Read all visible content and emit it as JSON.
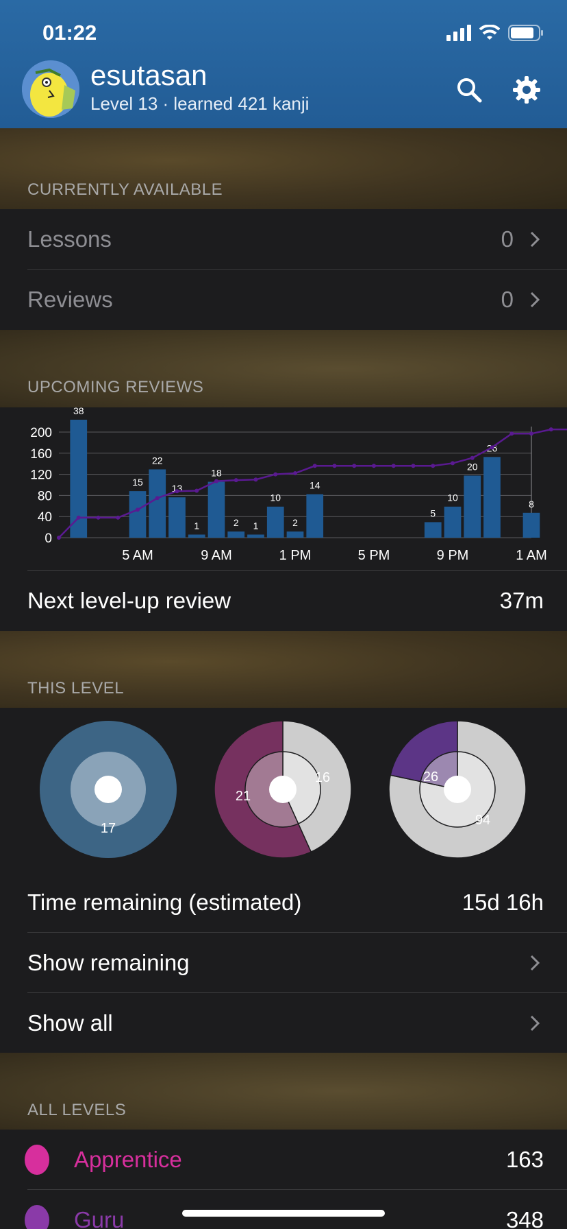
{
  "status_bar": {
    "time": "01:22"
  },
  "header": {
    "username": "esutasan",
    "subtitle": "Level 13 · learned 421 kanji"
  },
  "currently_available": {
    "title": "CURRENTLY AVAILABLE",
    "lessons": {
      "label": "Lessons",
      "value": "0"
    },
    "reviews": {
      "label": "Reviews",
      "value": "0"
    }
  },
  "upcoming_reviews": {
    "title": "UPCOMING REVIEWS"
  },
  "chart_data": {
    "type": "bar",
    "bars": [
      {
        "x": 1,
        "value": 38
      },
      {
        "x": 4,
        "value": 15
      },
      {
        "x": 5,
        "value": 22
      },
      {
        "x": 6,
        "value": 13
      },
      {
        "x": 7,
        "value": 1
      },
      {
        "x": 8,
        "value": 18
      },
      {
        "x": 9,
        "value": 2
      },
      {
        "x": 10,
        "value": 1
      },
      {
        "x": 11,
        "value": 10
      },
      {
        "x": 12,
        "value": 2
      },
      {
        "x": 13,
        "value": 14
      },
      {
        "x": 19,
        "value": 5
      },
      {
        "x": 20,
        "value": 10
      },
      {
        "x": 21,
        "value": 20
      },
      {
        "x": 22,
        "value": 26
      },
      {
        "x": 24,
        "value": 8
      }
    ],
    "bar_scale_max": 38,
    "cumulative_line": [
      0,
      38,
      38,
      38,
      53,
      75,
      88,
      89,
      107,
      109,
      110,
      120,
      122,
      136,
      136,
      136,
      136,
      136,
      136,
      136,
      141,
      151,
      171,
      197,
      197,
      205,
      205
    ],
    "ylim": [
      0,
      200
    ],
    "yticks": [
      200,
      160,
      120,
      80,
      40,
      0
    ],
    "xticks": [
      {
        "x": 4,
        "label": "5 AM"
      },
      {
        "x": 8,
        "label": "9 AM"
      },
      {
        "x": 12,
        "label": "1 PM"
      },
      {
        "x": 16,
        "label": "5 PM"
      },
      {
        "x": 20,
        "label": "9 PM"
      },
      {
        "x": 24,
        "label": "1 AM"
      }
    ],
    "bar_color": "#1f5a93",
    "line_color": "#5a1a91"
  },
  "next_level_up": {
    "label": "Next level-up review",
    "value": "37m"
  },
  "this_level": {
    "title": "THIS LEVEL",
    "donuts": [
      {
        "labels": [
          {
            "text": "17"
          }
        ],
        "outer": [
          {
            "value": 1,
            "color": "#3d6585"
          }
        ],
        "inner": [
          {
            "value": 1,
            "color": "#8aa3b8"
          }
        ]
      },
      {
        "labels": [
          {
            "text": "21"
          },
          {
            "text": "16"
          }
        ],
        "outer": [
          {
            "value": 16,
            "color": "#cdcdcd"
          },
          {
            "value": 21,
            "color": "#76315f"
          }
        ],
        "inner": [
          {
            "value": 16,
            "color": "#e2e2e2"
          },
          {
            "value": 21,
            "color": "#a27a93"
          }
        ]
      },
      {
        "labels": [
          {
            "text": "26"
          },
          {
            "text": "94"
          }
        ],
        "outer": [
          {
            "value": 94,
            "color": "#cdcdcd"
          },
          {
            "value": 26,
            "color": "#5c3586"
          }
        ],
        "inner": [
          {
            "value": 94,
            "color": "#e2e2e2"
          },
          {
            "value": 26,
            "color": "#9c88b0"
          }
        ]
      }
    ],
    "time_remaining": {
      "label": "Time remaining (estimated)",
      "value": "15d 16h"
    },
    "show_remaining": "Show remaining",
    "show_all": "Show all"
  },
  "all_levels": {
    "title": "ALL LEVELS",
    "items": [
      {
        "label": "Apprentice",
        "value": "163",
        "color": "#d72f9d"
      },
      {
        "label": "Guru",
        "value": "348",
        "color": "#8a3aa8"
      }
    ]
  }
}
